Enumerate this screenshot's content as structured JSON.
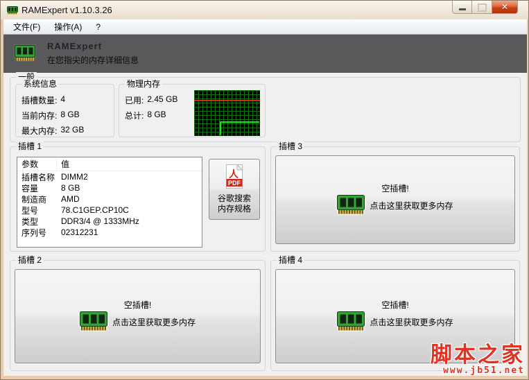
{
  "window": {
    "title": "RAMExpert v1.10.3.26",
    "controls": {
      "minimize_glyph": "",
      "maximize_glyph": "",
      "close_glyph": "✕"
    }
  },
  "menu": {
    "items": [
      "文件(F)",
      "操作(A)",
      "?"
    ]
  },
  "header": {
    "app_name": "RAMExpert",
    "tagline": "在您指尖的内存详细信息"
  },
  "general": {
    "label": "一般",
    "system_info": {
      "label": "系统信息",
      "rows": [
        [
          "插槽数量:",
          "4"
        ],
        [
          "当前内存:",
          "8 GB"
        ],
        [
          "最大内存:",
          "32 GB"
        ]
      ]
    },
    "physical_memory": {
      "label": "物理内存",
      "rows": [
        [
          "已用:",
          "2.45 GB"
        ],
        [
          "总计:",
          "8 GB"
        ]
      ],
      "graph": {
        "type": "line",
        "bg_color": "#000000",
        "grid_color": "#0f740f",
        "used_line_color": "#1be31b",
        "total_line_color": "#d3281c",
        "used_value_gb": 2.45,
        "total_value_gb": 8
      }
    }
  },
  "slot1": {
    "label": "插槽 1",
    "table": {
      "headers": [
        "参数",
        "值"
      ],
      "rows": [
        [
          "插槽名称",
          "DIMM2"
        ],
        [
          "容量",
          "8 GB"
        ],
        [
          "制造商",
          "AMD"
        ],
        [
          "型号",
          "78.C1GEP.CP10C"
        ],
        [
          "类型",
          "DDR3/4 @ 1333MHz"
        ],
        [
          "序列号",
          "02312231"
        ]
      ]
    },
    "pdf_button": {
      "icon_text": "PDF",
      "label_line1": "谷歌搜索",
      "label_line2": "内存规格"
    }
  },
  "slot2": {
    "label": "插槽 2",
    "empty_title": "空插槽!",
    "empty_subtitle": "点击这里获取更多内存"
  },
  "slot3": {
    "label": "插槽 3",
    "empty_title": "空插槽!",
    "empty_subtitle": "点击这里获取更多内存"
  },
  "slot4": {
    "label": "插槽 4",
    "empty_title": "空插槽!",
    "empty_subtitle": "点击这里获取更多内存"
  },
  "watermark": {
    "site_name": "脚本之家",
    "site_url": "www.jb51.net"
  },
  "colors": {
    "frame": "#e9cbab",
    "header_bg": "#59595b",
    "client_bg": "#f0f0f0",
    "close_button_red": "#cc4014",
    "watermark_red": "#e03322",
    "ram_green": "#36a136"
  }
}
